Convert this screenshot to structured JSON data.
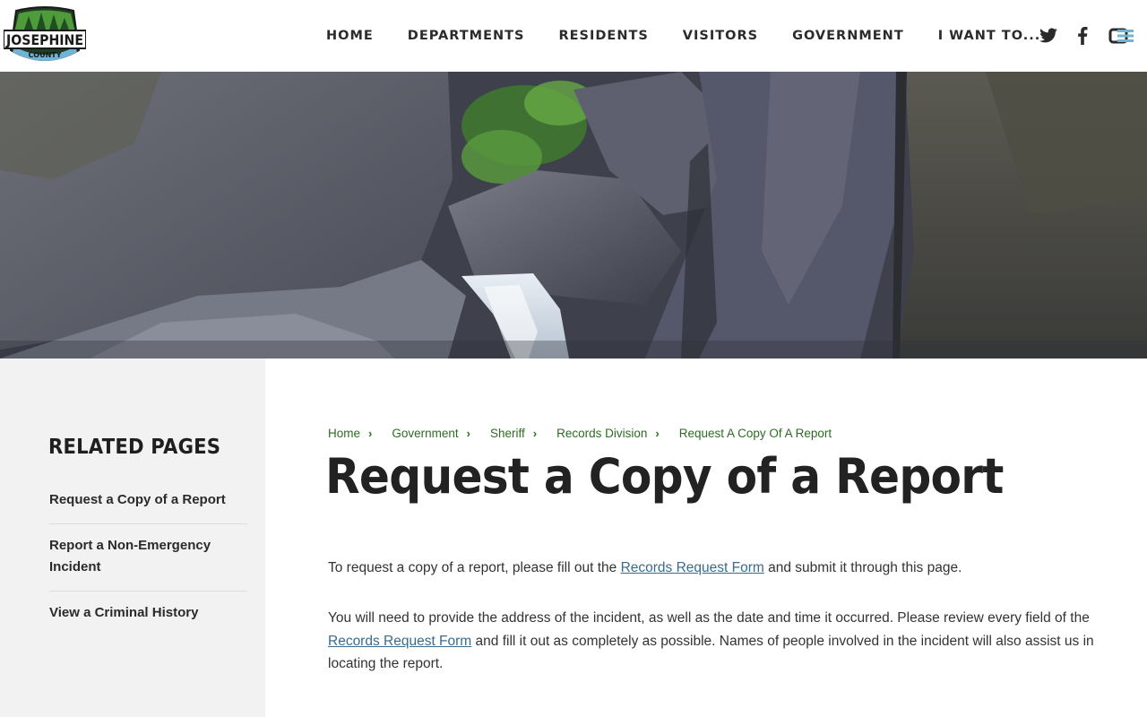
{
  "header": {
    "logo_text": "JOSEPHINE",
    "logo_subtext": "COUNTY",
    "nav": [
      {
        "label": "HOME"
      },
      {
        "label": "DEPARTMENTS"
      },
      {
        "label": "RESIDENTS"
      },
      {
        "label": "VISITORS"
      },
      {
        "label": "GOVERNMENT"
      },
      {
        "label": "I WANT TO..."
      }
    ],
    "social_icons": [
      "twitter-icon",
      "facebook-icon",
      "menu-icon"
    ]
  },
  "sidebar": {
    "heading": "RELATED PAGES",
    "items": [
      {
        "label": "Request a Copy of a Report"
      },
      {
        "label": "Report a Non-Emergency Incident"
      },
      {
        "label": "View a Criminal History"
      }
    ]
  },
  "breadcrumb": [
    {
      "label": "Home"
    },
    {
      "label": "Government"
    },
    {
      "label": "Sheriff"
    },
    {
      "label": "Records Division"
    },
    {
      "label": "Request A Copy Of A Report"
    }
  ],
  "page": {
    "title": "Request a Copy of a Report",
    "p1_before": "To request a copy of a report, please fill out the ",
    "p1_link": "Records Request Form",
    "p1_after": " and submit it through this page.",
    "p2_before": "You will need to provide the address of the incident, as well as the date and time it occurred. Please review every field of the ",
    "p2_link": "Records Request Form",
    "p2_after": " and fill it out as completely as possible. Names of people involved in the incident will also assist us in locating the report."
  },
  "colors": {
    "brand_green": "#2e6b24",
    "link_blue": "#3a6b8c",
    "sidebar_bg": "#f2f2f2"
  }
}
